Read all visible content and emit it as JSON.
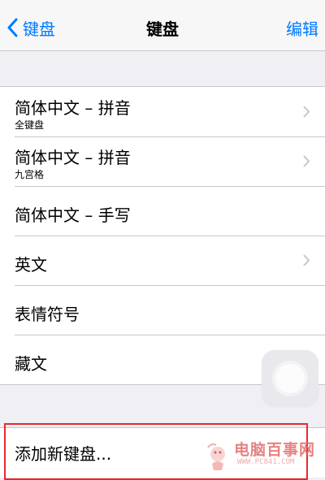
{
  "navbar": {
    "back_label": "键盘",
    "title": "键盘",
    "edit_label": "编辑"
  },
  "keyboards": [
    {
      "title": "简体中文 – 拼音",
      "subtitle": "全键盘",
      "chevron": true
    },
    {
      "title": "简体中文 – 拼音",
      "subtitle": "九宫格",
      "chevron": true
    },
    {
      "title": "简体中文 – 手写",
      "subtitle": "",
      "chevron": false
    },
    {
      "title": "英文",
      "subtitle": "",
      "chevron": true
    },
    {
      "title": "表情符号",
      "subtitle": "",
      "chevron": false
    },
    {
      "title": "藏文",
      "subtitle": "",
      "chevron": false
    }
  ],
  "add_keyboard_label": "添加新键盘...",
  "watermark": {
    "text": "电脑百事网",
    "sub": "WWW.PC841.COM"
  },
  "colors": {
    "accent": "#007aff",
    "background": "#efeff4",
    "highlight": "#e8282e",
    "separator": "#c8c7cc"
  }
}
